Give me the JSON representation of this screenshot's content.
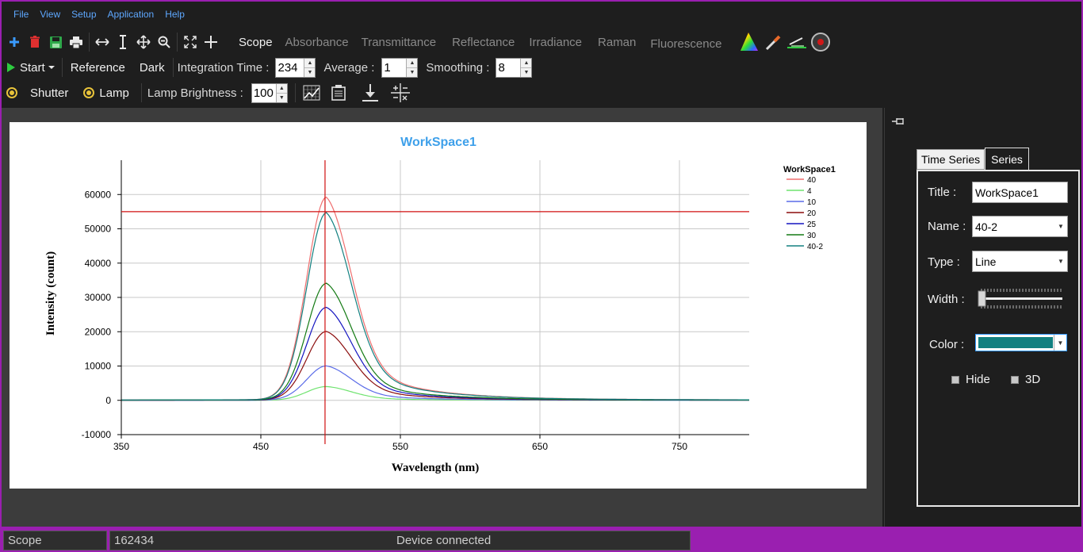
{
  "menu": [
    "File",
    "View",
    "Setup",
    "Application",
    "Help"
  ],
  "toolbar": {
    "icons": [
      "add-icon",
      "delete-icon",
      "save-icon",
      "print-icon",
      "fit-width-icon",
      "fit-height-icon",
      "pan-icon",
      "zoom-out-icon",
      "fit-all-icon",
      "crosshair-icon"
    ],
    "modes": [
      "Scope",
      "Absorbance",
      "Transmittance",
      "Reflectance",
      "Irradiance",
      "Raman",
      "Fluorescence"
    ],
    "active_mode": "Scope",
    "right_icons": [
      "color-prism-icon",
      "pipette-icon",
      "baseline-icon",
      "record-icon"
    ]
  },
  "acquisition": {
    "start_label": "Start",
    "reference_label": "Reference",
    "dark_label": "Dark",
    "integration_label": "Integration Time :",
    "integration_value": "234",
    "average_label": "Average :",
    "average_value": "1",
    "smoothing_label": "Smoothing :",
    "smoothing_value": "8"
  },
  "lamp": {
    "shutter_label": "Shutter",
    "lamp_label": "Lamp",
    "brightness_label": "Lamp Brightness :",
    "brightness_value": "100",
    "icons": [
      "grid-chart-icon",
      "clipboard-icon",
      "download-icon",
      "math-ops-icon"
    ]
  },
  "chart_data": {
    "type": "line",
    "title": "WorkSpace1",
    "xlabel": "Wavelength (nm)",
    "ylabel": "Intensity (count)",
    "xlim": [
      350,
      800
    ],
    "ylim": [
      -10000,
      70000
    ],
    "xticks": [
      350,
      450,
      550,
      650,
      750
    ],
    "yticks": [
      -10000,
      0,
      10000,
      20000,
      30000,
      40000,
      50000,
      60000
    ],
    "grid": true,
    "legend_title": "WorkSpace1",
    "legend_position": "top-right",
    "cursor": {
      "x": 496,
      "y": 55000
    },
    "series": [
      {
        "name": "40",
        "color": "#ef6f6f",
        "peak": 59000
      },
      {
        "name": "4",
        "color": "#6fe36f",
        "peak": 4000
      },
      {
        "name": "10",
        "color": "#5a6be8",
        "peak": 10000
      },
      {
        "name": "20",
        "color": "#8b0d0d",
        "peak": 20000
      },
      {
        "name": "25",
        "color": "#1414c0",
        "peak": 27000
      },
      {
        "name": "30",
        "color": "#137a13",
        "peak": 34000
      },
      {
        "name": "40-2",
        "color": "#138080",
        "peak": 54500
      }
    ],
    "peak_wavelength": 497
  },
  "panel": {
    "tabs": [
      "Time Series",
      "Series"
    ],
    "active_tab": "Series",
    "title_label": "Title :",
    "title_value": "WorkSpace1",
    "name_label": "Name :",
    "name_value": "40-2",
    "type_label": "Type :",
    "type_value": "Line",
    "width_label": "Width :",
    "width_value": 1,
    "color_label": "Color :",
    "color_value": "#128080",
    "hide_label": "Hide",
    "threed_label": "3D"
  },
  "status": {
    "mode": "Scope",
    "serial": "162434",
    "message": "Device  connected"
  }
}
